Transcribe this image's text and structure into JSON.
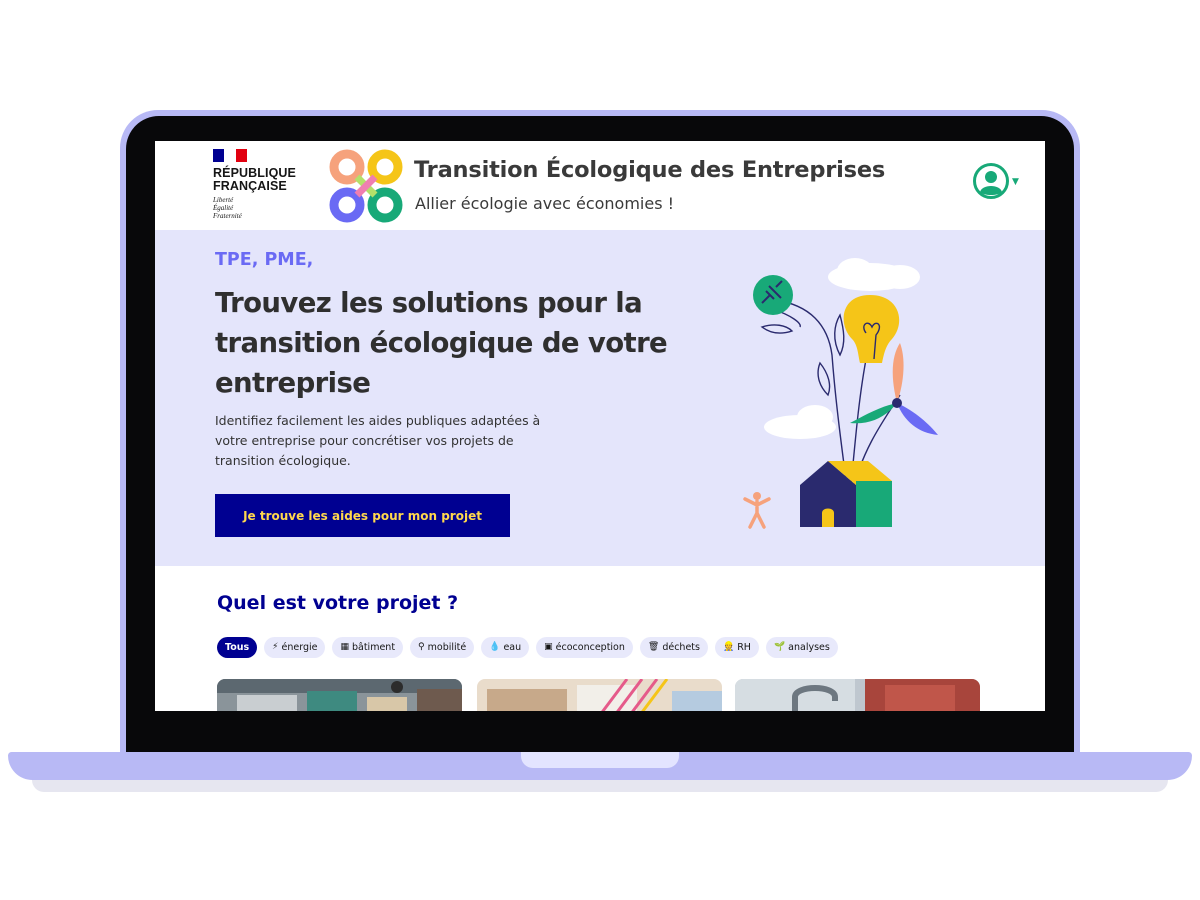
{
  "colors": {
    "frame": "#b8b9f5",
    "primary_blue": "#000091",
    "accent_purple": "#6a6af4",
    "hero_bg": "#e4e5fb",
    "cta_text": "#ffd84d",
    "account_green": "#18a978"
  },
  "header": {
    "republic_name_line1": "RÉPUBLIQUE",
    "republic_name_line2": "FRANÇAISE",
    "motto_line1": "Liberté",
    "motto_line2": "Égalité",
    "motto_line3": "Fraternité",
    "site_title": "Transition Écologique des Entreprises",
    "tagline": "Allier écologie avec économies !",
    "account_icon": "user-account-icon"
  },
  "hero": {
    "kicker": "TPE, PME,",
    "title": "Trouvez les solutions pour la transition écologique de votre entreprise",
    "description": "Identifiez facilement les aides publiques adaptées à votre entreprise pour concrétiser vos projets de transition écologique.",
    "cta_label": "Je trouve les aides pour mon projet"
  },
  "projects": {
    "title": "Quel est votre projet ?",
    "filters": [
      {
        "label": "Tous",
        "icon": "",
        "active": true
      },
      {
        "label": "énergie",
        "icon": "⚡",
        "active": false
      },
      {
        "label": "bâtiment",
        "icon": "▦",
        "active": false
      },
      {
        "label": "mobilité",
        "icon": "⚲",
        "active": false
      },
      {
        "label": "eau",
        "icon": "💧",
        "active": false
      },
      {
        "label": "écoconception",
        "icon": "▣",
        "active": false
      },
      {
        "label": "déchets",
        "icon": "🗑",
        "active": false
      },
      {
        "label": "RH",
        "icon": "👷",
        "active": false
      },
      {
        "label": "analyses",
        "icon": "🌱",
        "active": false
      }
    ]
  }
}
